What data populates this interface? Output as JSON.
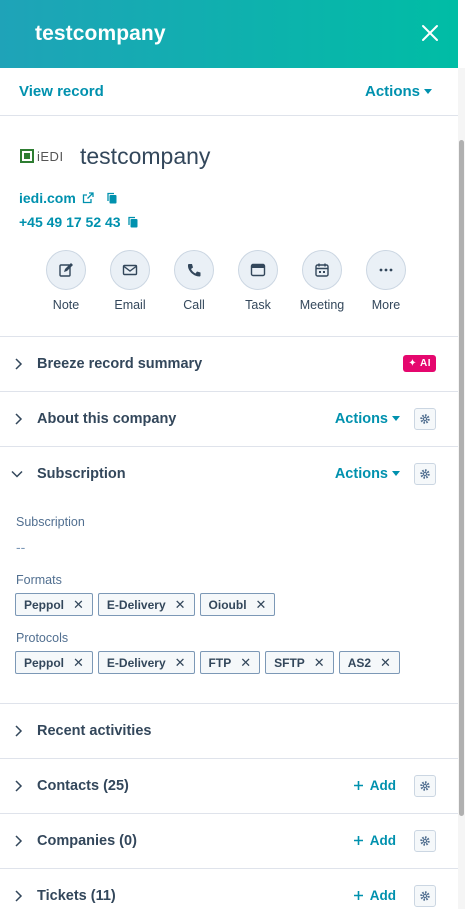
{
  "header": {
    "title": "testcompany"
  },
  "topbar": {
    "view_record": "View record",
    "actions": "Actions"
  },
  "company": {
    "logo_text": "iEDI",
    "name": "testcompany",
    "domain": "iedi.com",
    "phone": "+45 49 17 52 43"
  },
  "quick_actions": [
    {
      "label": "Note",
      "icon": "note-icon"
    },
    {
      "label": "Email",
      "icon": "email-icon"
    },
    {
      "label": "Call",
      "icon": "phone-icon"
    },
    {
      "label": "Task",
      "icon": "task-icon"
    },
    {
      "label": "Meeting",
      "icon": "calendar-icon"
    },
    {
      "label": "More",
      "icon": "more-icon"
    }
  ],
  "sections": {
    "breeze": {
      "title": "Breeze record summary",
      "badge": "✦ AI"
    },
    "about": {
      "title": "About this company",
      "actions": "Actions"
    },
    "subscription": {
      "title": "Subscription",
      "actions": "Actions",
      "subscription_label": "Subscription",
      "subscription_value": "--",
      "formats_label": "Formats",
      "formats": [
        "Peppol",
        "E-Delivery",
        "Oioubl"
      ],
      "protocols_label": "Protocols",
      "protocols": [
        "Peppol",
        "E-Delivery",
        "FTP",
        "SFTP",
        "AS2"
      ]
    },
    "recent": {
      "title": "Recent activities"
    },
    "contacts": {
      "title": "Contacts (25)",
      "add": "Add"
    },
    "companies": {
      "title": "Companies (0)",
      "add": "Add"
    },
    "tickets": {
      "title": "Tickets (11)",
      "add": "Add"
    }
  },
  "colors": {
    "accent": "#0091ae",
    "header_start": "#1fa3b8",
    "header_end": "#00bda5",
    "ai_badge": "#e5076e"
  }
}
